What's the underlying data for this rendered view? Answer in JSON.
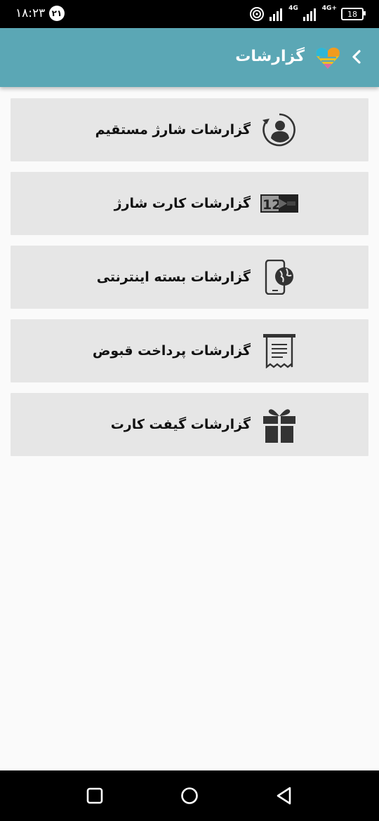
{
  "status_bar": {
    "time": "۱۸:۲۳",
    "notification_count": "۲۱",
    "network_1": "4G",
    "network_2": "4G+",
    "battery": "18"
  },
  "header": {
    "title": "گزارشات",
    "back_icon": "chevron-left-icon",
    "logo_icon": "heart-logo-icon"
  },
  "menu": {
    "items": [
      {
        "label": "گزارشات شارژ مستقیم",
        "icon": "user-refresh-icon"
      },
      {
        "label": "گزارشات کارت شارژ",
        "icon": "charge-card-icon"
      },
      {
        "label": "گزارشات بسته اینترنتی",
        "icon": "phone-globe-icon"
      },
      {
        "label": "گزارشات پرداخت قبوض",
        "icon": "receipt-icon"
      },
      {
        "label": "گزارشات گیفت کارت",
        "icon": "gift-icon"
      }
    ]
  },
  "colors": {
    "app_bar": "#5ba7b5",
    "item_bg": "#e6e6e6",
    "page_bg": "#fafafa"
  }
}
